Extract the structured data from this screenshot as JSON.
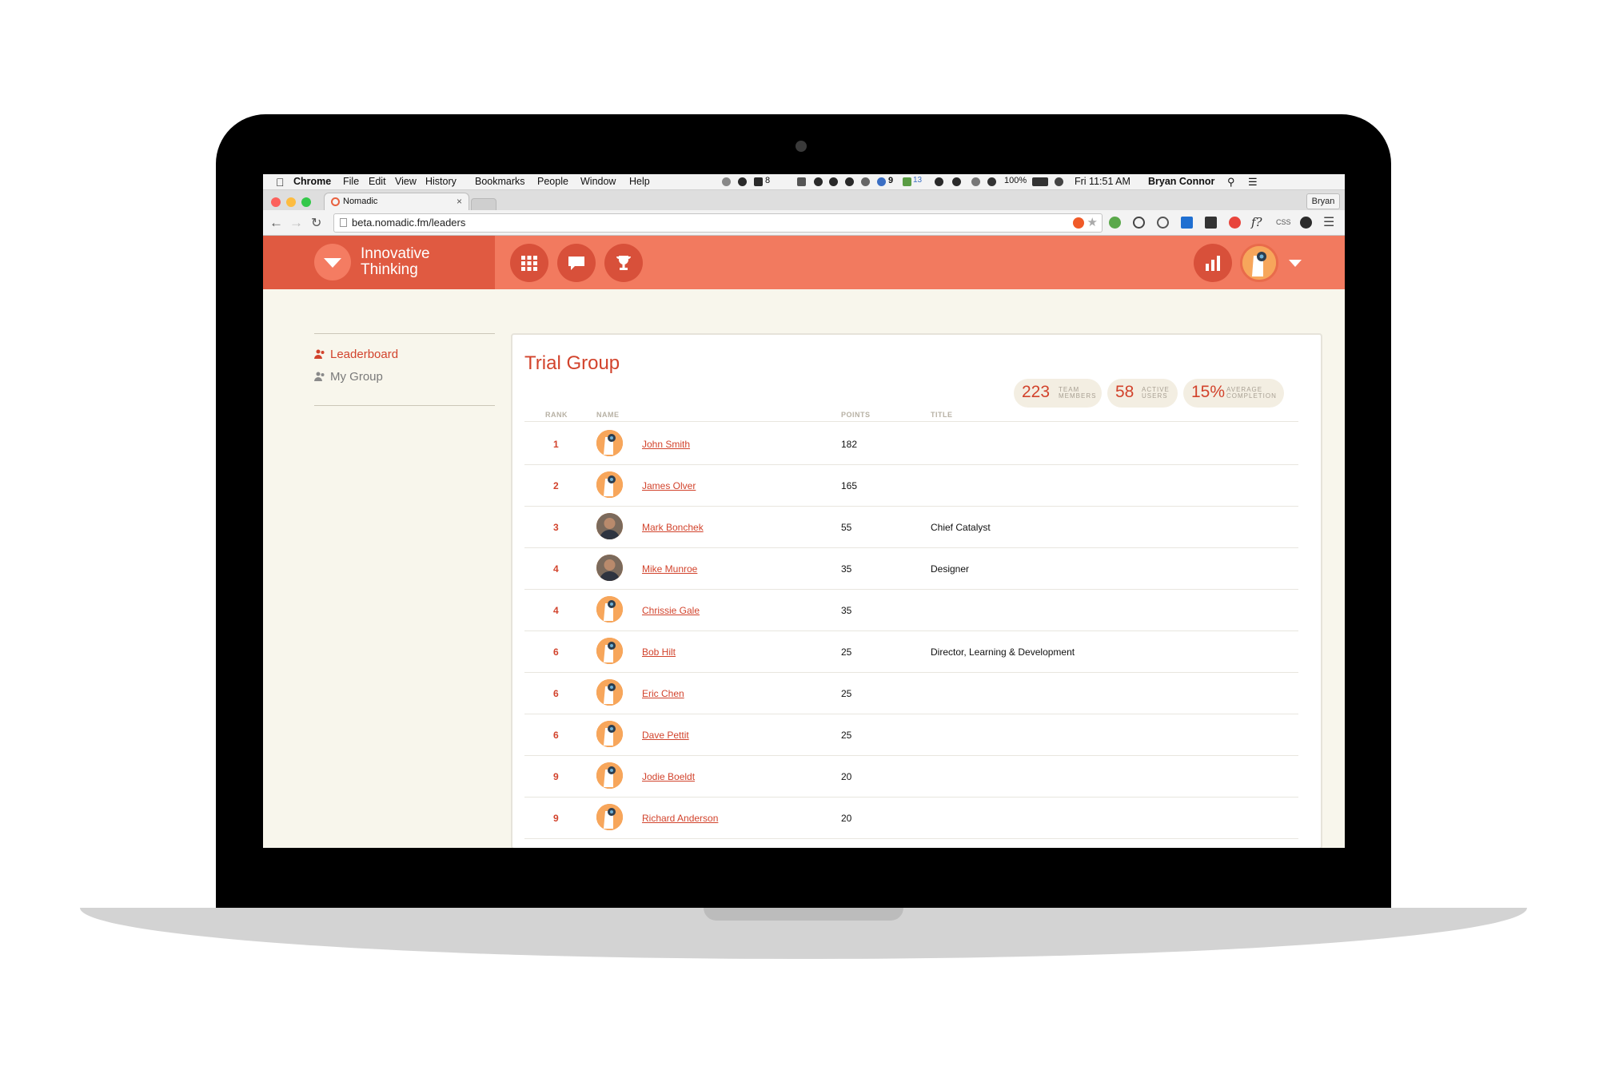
{
  "menubar": {
    "app": "Chrome",
    "items": [
      "File",
      "Edit",
      "View",
      "History",
      "Bookmarks",
      "People",
      "Window",
      "Help"
    ],
    "tray_badge_1": "8",
    "tray_badge_2": "9",
    "tray_badge_3": "13",
    "battery": "100%",
    "clock": "Fri 11:51 AM",
    "user": "Bryan Connor"
  },
  "browser": {
    "tab_title": "Nomadic",
    "tab_close": "×",
    "profile": "Bryan",
    "url": "beta.nomadic.fm/leaders",
    "ext_text_1": "f?",
    "ext_text_2": "CSS"
  },
  "app": {
    "brand_line1": "Innovative",
    "brand_line2": "Thinking"
  },
  "sidebar": {
    "items": [
      {
        "label": "Leaderboard",
        "active": true
      },
      {
        "label": "My Group",
        "active": false
      }
    ]
  },
  "leaderboard": {
    "title": "Trial Group",
    "stats": [
      {
        "value": "223",
        "label1": "TEAM",
        "label2": "MEMBERS"
      },
      {
        "value": "58",
        "label1": "ACTIVE",
        "label2": "USERS"
      },
      {
        "value": "15%",
        "label1": "AVERAGE",
        "label2": "COMPLETION"
      }
    ],
    "columns": {
      "rank": "RANK",
      "name": "NAME",
      "points": "POINTS",
      "title": "TITLE"
    },
    "rows": [
      {
        "rank": "1",
        "name": "John Smith",
        "points": "182",
        "title": "",
        "avatar": "default-avatar"
      },
      {
        "rank": "2",
        "name": "James Olver",
        "points": "165",
        "title": "",
        "avatar": "default-avatar"
      },
      {
        "rank": "3",
        "name": "Mark Bonchek",
        "points": "55",
        "title": "Chief Catalyst",
        "avatar": "photo"
      },
      {
        "rank": "4",
        "name": "Mike Munroe",
        "points": "35",
        "title": "Designer",
        "avatar": "photo"
      },
      {
        "rank": "4",
        "name": "Chrissie Gale",
        "points": "35",
        "title": "",
        "avatar": "default-avatar"
      },
      {
        "rank": "6",
        "name": "Bob Hilt",
        "points": "25",
        "title": "Director, Learning & Development",
        "avatar": "default-avatar"
      },
      {
        "rank": "6",
        "name": "Eric Chen",
        "points": "25",
        "title": "",
        "avatar": "default-avatar"
      },
      {
        "rank": "6",
        "name": "Dave Pettit",
        "points": "25",
        "title": "",
        "avatar": "default-avatar"
      },
      {
        "rank": "9",
        "name": "Jodie Boeldt",
        "points": "20",
        "title": "",
        "avatar": "default-avatar"
      },
      {
        "rank": "9",
        "name": "Richard Anderson",
        "points": "20",
        "title": "",
        "avatar": "default-avatar"
      }
    ]
  },
  "colors": {
    "accent": "#d2432c",
    "header": "#f27a5f",
    "brand_block": "#e05a41",
    "page_bg": "#f8f6ec"
  }
}
